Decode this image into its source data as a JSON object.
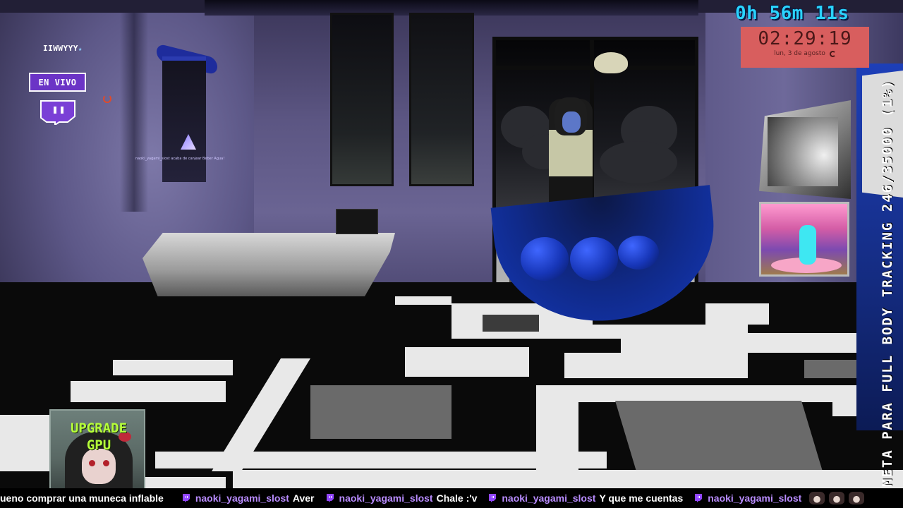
{
  "overlay": {
    "username_tag": "IIWWYYY",
    "live_label": "EN VIVO",
    "redeem_text": "naoki_yagami_slost acaba de canjear Beber Agua!"
  },
  "timers": {
    "stream_elapsed": "0h 56m 11s",
    "clock_time": "02:29:19",
    "clock_date": "lun, 3 de agosto"
  },
  "goal": {
    "text": "META PARA FULL BODY TRACKING 246/35000 (1%)",
    "current": 246,
    "target": 35000,
    "percent": 1
  },
  "upgrade_card": {
    "line1": "UPGRADE",
    "line2": "GPU"
  },
  "chat": {
    "first_fragment": "ueno comprar una muneca inflable",
    "messages": [
      {
        "user": "naoki_yagami_slost",
        "text": "Aver"
      },
      {
        "user": "naoki_yagami_slost",
        "text": "Chale :'v"
      },
      {
        "user": "naoki_yagami_slost",
        "text": "Y que me cuentas"
      },
      {
        "user": "naoki_yagami_slost",
        "text": ""
      }
    ]
  },
  "colors": {
    "twitch_purple": "#9146ff",
    "timer_cyan": "#2ad3ff",
    "clock_bg": "#d85e5e",
    "upgrade_green": "#b6ff3a"
  },
  "icons": [
    "twitch-logo-icon",
    "record-indicator-icon",
    "moon-icon",
    "twitch-chat-icon",
    "emote-icon"
  ]
}
